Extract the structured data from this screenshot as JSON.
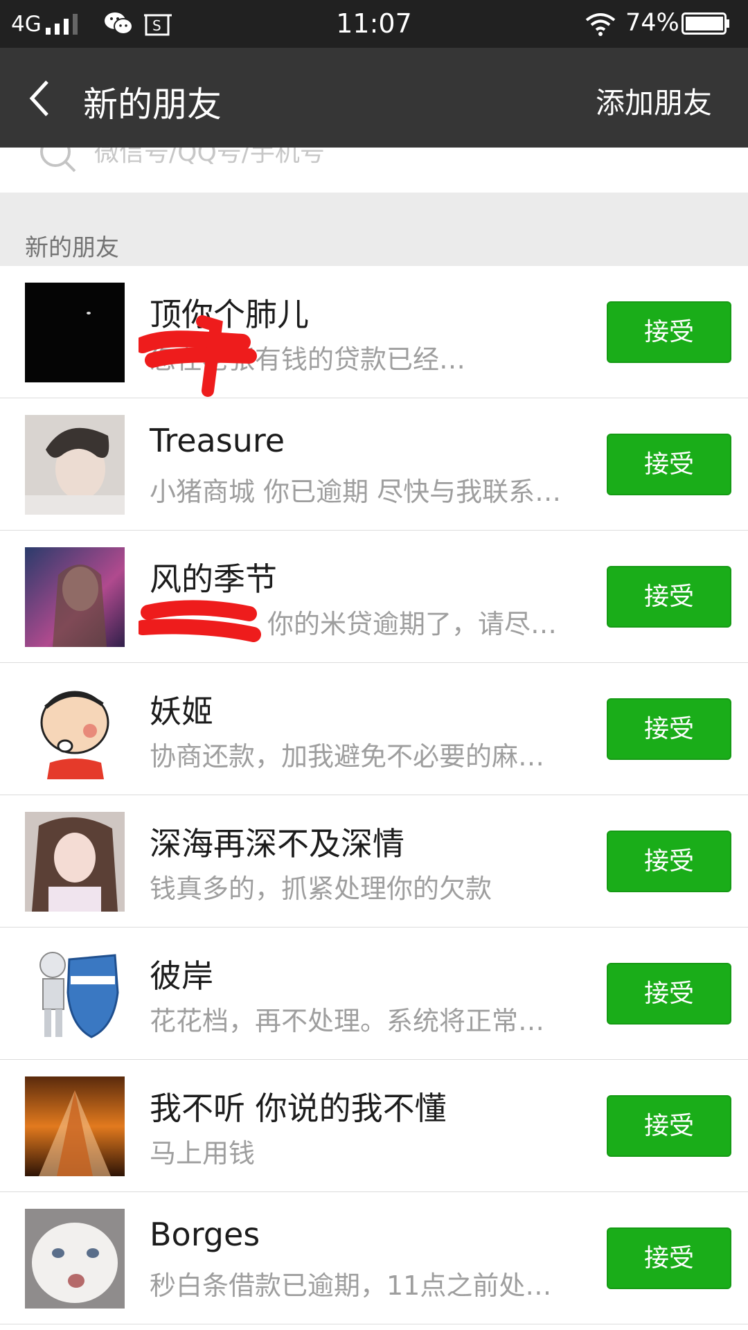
{
  "status_bar": {
    "network": "4G",
    "time": "11:07",
    "battery_percent": "74%",
    "icons": [
      "signal-icon",
      "wechat-icon",
      "gallery-icon",
      "wifi-icon",
      "battery-icon"
    ]
  },
  "nav": {
    "title": "新的朋友",
    "add_friends": "添加朋友",
    "back_icon": "chevron-left-icon"
  },
  "search": {
    "placeholder": "微信号/QQ号/手机号"
  },
  "section": {
    "title": "新的朋友"
  },
  "accept_color": "#1aad19",
  "requests": [
    {
      "name": "顶你个肺儿",
      "message": "您在老张有钱的贷款已经…",
      "accept_label": "接受"
    },
    {
      "name": "Treasure",
      "message": "小猪商城 你已逾期 尽快与我联系…",
      "accept_label": "接受"
    },
    {
      "name": "风的季节",
      "message": "你的米贷逾期了，请尽…",
      "accept_label": "接受"
    },
    {
      "name": "妖姬",
      "message": "协商还款，加我避免不必要的麻…",
      "accept_label": "接受"
    },
    {
      "name": "深海再深不及深情",
      "message": "钱真多的，抓紧处理你的欠款",
      "accept_label": "接受"
    },
    {
      "name": "彼岸",
      "message": "花花档，再不处理。系统将正常…",
      "accept_label": "接受"
    },
    {
      "name": "我不听 你说的我不懂",
      "message": "马上用钱",
      "accept_label": "接受"
    },
    {
      "name": "Borges",
      "message": "秒白条借款已逾期，11点之前处…",
      "accept_label": "接受"
    }
  ]
}
